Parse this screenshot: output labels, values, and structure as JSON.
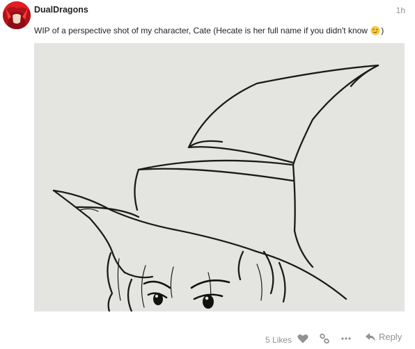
{
  "post": {
    "username": "DualDragons",
    "time": "1h",
    "text_before": "WIP of a perspective shot of my character, Cate (Hecate is her full name if you didn't know ",
    "text_after": ")",
    "emoji": "wink-emoji",
    "image_subject": "pen sketch of witch hat over character eyes"
  },
  "actions": {
    "likes_label": "5 Likes",
    "reply_label": "Reply",
    "icons": [
      "heart-icon",
      "link-icon",
      "more-icon",
      "reply-icon"
    ]
  },
  "colors": {
    "username": "#222222",
    "muted": "#919191",
    "avatar": "#c0141b",
    "paper": "#e5e5e2",
    "ink": "#1a1a1a"
  }
}
